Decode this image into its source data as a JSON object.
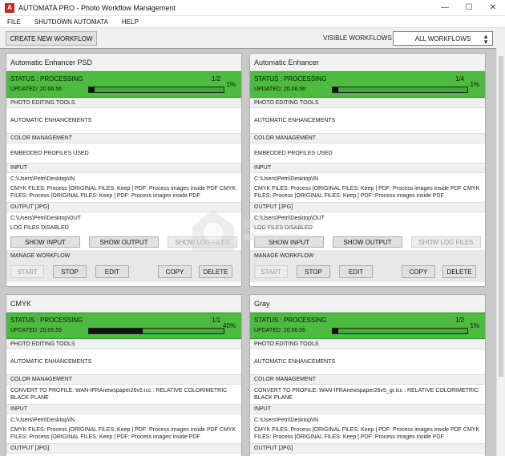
{
  "window": {
    "app_icon": "A",
    "title": "AUTOMATA PRO - Photo Workflow Management",
    "minimize": "—",
    "maximize": "☐",
    "close": "✕"
  },
  "menu": [
    "FILE",
    "SHUTDOWN AUTOMATA",
    "HELP"
  ],
  "toolbar": {
    "create_label": "CREATE NEW WORKFLOW",
    "visible_label": "VISIBLE WORKFLOWS",
    "visible_value": "ALL WORKFLOWS"
  },
  "cards": [
    {
      "title": "Automatic Enhancer PSD",
      "status": "STATUS : PROCESSING",
      "updated": "UPDATED: 20.06.56",
      "count": "1/2",
      "percent": "1%",
      "progress": 0.04,
      "tools_head": "PHOTO EDITING TOOLS",
      "tools": "AUTOMATIC ENHANCEMENTS",
      "color_head": "COLOR MANAGEMENT",
      "color": "EMBEDDED PROFILES USED",
      "input_head": "INPUT",
      "input_path": "C:\\Users\\Petri\\Desktop\\IN",
      "input_desc": "CMYK FILES: Process |ORIGINAL FILES: Keep | PDF: Process images inside PDF CMYK FILES: Process |ORIGINAL FILES: Keep | PDF: Process images inside PDF",
      "output_head": "OUTPUT [JPG]",
      "output_path": "C:\\Users\\Petri\\Desktop\\OUT",
      "log": "LOG FILES DISABLED",
      "show_input": "SHOW INPUT",
      "show_output": "SHOW OUTPUT",
      "show_log": "SHOW LOG FILES",
      "manage_head": "MANAGE WORKFLOW",
      "start": "START",
      "stop": "STOP",
      "edit": "EDIT",
      "copy": "COPY",
      "delete": "DELETE"
    },
    {
      "title": "Automatic Enhancer",
      "status": "STATUS : PROCESSING",
      "updated": "UPDATED: 20.06.56",
      "count": "1/4",
      "percent": "1%",
      "progress": 0.04,
      "tools_head": "PHOTO EDITING TOOLS",
      "tools": "AUTOMATIC ENHANCEMENTS",
      "color_head": "COLOR MANAGEMENT",
      "color": "EMBEDDED PROFILES USED",
      "input_head": "INPUT",
      "input_path": "C:\\Users\\Petri\\Desktop\\IN",
      "input_desc": "CMYK FILES: Process |ORIGINAL FILES: Keep | PDF: Process images inside PDF CMYK FILES: Process |ORIGINAL FILES: Keep | PDF: Process images inside PDF",
      "output_head": "OUTPUT [JPG]",
      "output_path": "C:\\Users\\Petri\\Desktop\\OUT",
      "log": "LOG FILES DISABLED",
      "show_input": "SHOW INPUT",
      "show_output": "SHOW OUTPUT",
      "show_log": "SHOW LOG FILES",
      "manage_head": "MANAGE WORKFLOW",
      "start": "START",
      "stop": "STOP",
      "edit": "EDIT",
      "copy": "COPY",
      "delete": "DELETE"
    },
    {
      "title": "CMYK",
      "status": "STATUS : PROCESSING",
      "updated": "UPDATED: 20.06.56",
      "count": "1/1",
      "percent": "40%",
      "progress": 0.4,
      "tools_head": "PHOTO EDITING TOOLS",
      "tools": "AUTOMATIC ENHANCEMENTS",
      "color_head": "COLOR MANAGEMENT",
      "color": "CONVERT TO PROFILE: WAN-IFRAnewspaper26v5.icc : RELATIVE COLORIMETRIC BLACK PLANE",
      "input_head": "INPUT",
      "input_path": "C:\\Users\\Petri\\Desktop\\IN",
      "input_desc": "CMYK FILES: Process |ORIGINAL FILES: Keep | PDF: Process images inside PDF CMYK FILES: Process |ORIGINAL FILES: Keep | PDF: Process images inside PDF",
      "output_head": "OUTPUT [JPG]"
    },
    {
      "title": "Gray",
      "status": "STATUS : PROCESSING",
      "updated": "UPDATED: 20.06.56",
      "count": "1/2",
      "percent": "1%",
      "progress": 0.04,
      "tools_head": "PHOTO EDITING TOOLS",
      "tools": "AUTOMATIC ENHANCEMENTS",
      "color_head": "COLOR MANAGEMENT",
      "color": "CONVERT TO PROFILE: WAN-IFRAnewspaper26v5_gr.icc : RELATIVE COLORIMETRIC BLACK PLANE",
      "input_head": "INPUT",
      "input_path": "C:\\Users\\Petri\\Desktop\\IN",
      "input_desc": "CMYK FILES: Process |ORIGINAL FILES: Keep | PDF: Process images inside PDF CMYK FILES: Process |ORIGINAL FILES: Keep | PDF: Process images inside PDF",
      "output_head": "OUTPUT [JPG]"
    }
  ],
  "colors": {
    "status_green": "#4cbb3f",
    "panel_gray": "#c9c9c9",
    "app_icon_red": "#c62828"
  }
}
